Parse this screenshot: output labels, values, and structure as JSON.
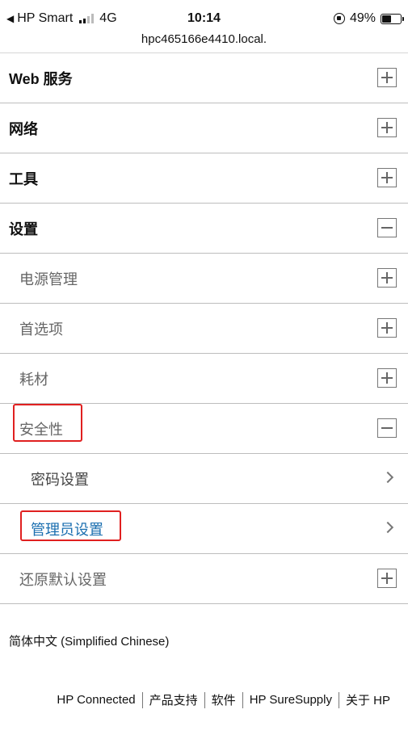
{
  "status_bar": {
    "carrier": "HP Smart",
    "network": "4G",
    "time": "10:14",
    "battery": "49%",
    "url": "hpc465166e4410.local."
  },
  "menu": [
    {
      "id": "web-services",
      "label": "Web 服务",
      "level": 0,
      "state": "collapsed"
    },
    {
      "id": "network",
      "label": "网络",
      "level": 0,
      "state": "collapsed"
    },
    {
      "id": "tools",
      "label": "工具",
      "level": 0,
      "state": "collapsed"
    },
    {
      "id": "settings",
      "label": "设置",
      "level": 0,
      "state": "expanded"
    },
    {
      "id": "power-management",
      "label": "电源管理",
      "level": 1,
      "state": "collapsed"
    },
    {
      "id": "preferences",
      "label": "首选项",
      "level": 1,
      "state": "collapsed"
    },
    {
      "id": "supplies",
      "label": "耗材",
      "level": 1,
      "state": "collapsed"
    },
    {
      "id": "security",
      "label": "安全性",
      "level": 1,
      "state": "expanded"
    },
    {
      "id": "password-settings",
      "label": "密码设置",
      "level": 2,
      "state": "link"
    },
    {
      "id": "admin-settings",
      "label": "管理员设置",
      "level": 2,
      "state": "link"
    },
    {
      "id": "restore-defaults",
      "label": "还原默认设置",
      "level": 1,
      "state": "collapsed"
    }
  ],
  "language": "简体中文 (Simplified Chinese)",
  "footer_links": [
    "HP Connected",
    "产品支持",
    "软件",
    "HP SureSupply",
    "关于 HP"
  ],
  "colors": {
    "link": "#1b6fb0",
    "highlight": "#e02020",
    "divider": "#bdbdbd"
  }
}
